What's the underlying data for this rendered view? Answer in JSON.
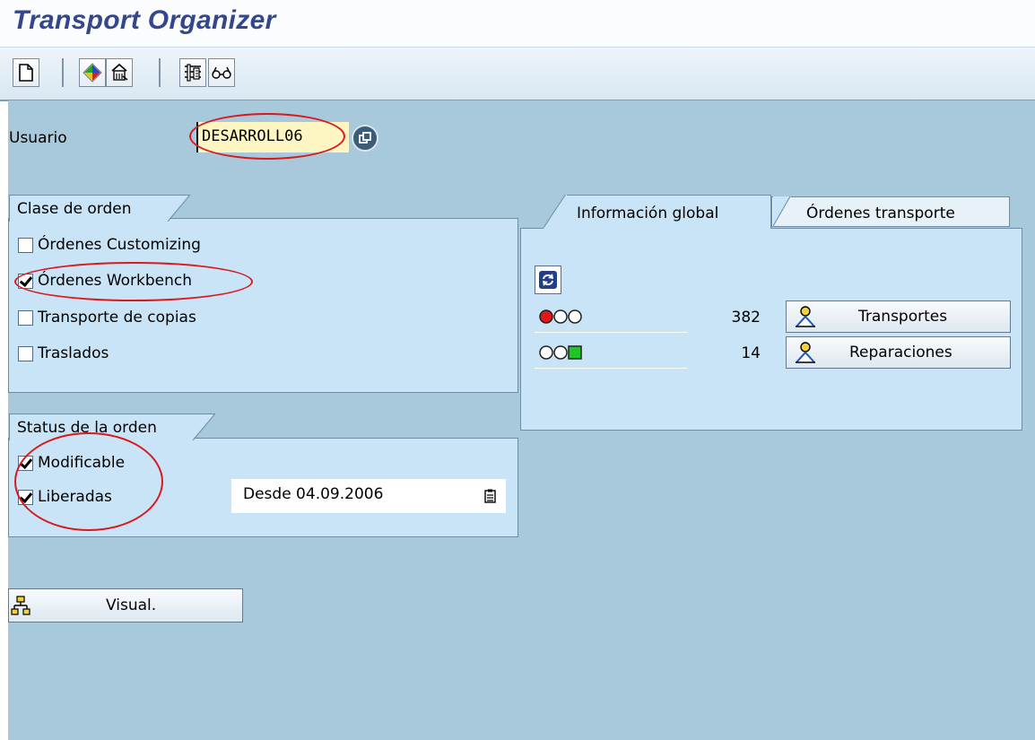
{
  "window": {
    "title": "Transport Organizer"
  },
  "toolbar": {
    "buttons": [
      {
        "name": "new-document-icon"
      },
      {
        "name": "display-object-icon"
      },
      {
        "name": "home-transport-icon"
      },
      {
        "name": "filter-settings-icon"
      },
      {
        "name": "glasses-icon"
      }
    ]
  },
  "usuario": {
    "label": "Usuario",
    "value": "DESARROLL06"
  },
  "clase_de_orden": {
    "title": "Clase de orden",
    "options": [
      {
        "label": "Órdenes Customizing",
        "checked": false
      },
      {
        "label": "Órdenes Workbench",
        "checked": true
      },
      {
        "label": "Transporte de copias",
        "checked": false
      },
      {
        "label": "Traslados",
        "checked": false
      }
    ]
  },
  "status_de_la_orden": {
    "title": "Status de la orden",
    "options": [
      {
        "label": "Modificable",
        "checked": true
      },
      {
        "label": "Liberadas",
        "checked": true
      }
    ],
    "desde": "Desde 04.09.2006"
  },
  "tabs": [
    {
      "label": "Información global",
      "active": true
    },
    {
      "label": "Órdenes transporte",
      "active": false
    }
  ],
  "global_info": {
    "rows": [
      {
        "status": "red",
        "count": "382",
        "button": "Transportes"
      },
      {
        "status": "green",
        "count": "14",
        "button": "Reparaciones"
      }
    ]
  },
  "visual_button": {
    "label": "Visual."
  },
  "colors": {
    "accent": "#34468c",
    "work_bg": "#a8c8dc",
    "panel_bg": "#c8e4f6",
    "highlight": "#d8191d"
  }
}
